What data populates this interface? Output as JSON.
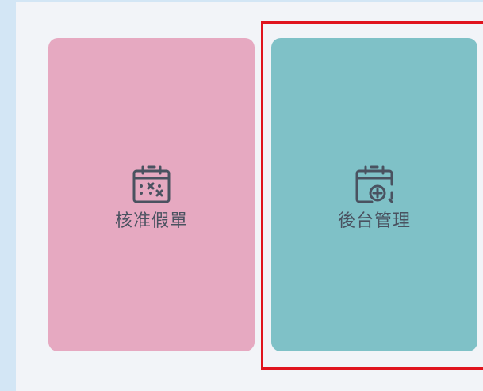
{
  "cards": [
    {
      "label": "核准假單",
      "icon": "calendar-x-icon",
      "color": "#e6a9c1"
    },
    {
      "label": "後台管理",
      "icon": "calendar-plus-icon",
      "color": "#7fc1c7"
    }
  ],
  "colors": {
    "panel_bg": "#f2f4f8",
    "page_bg": "#d3e6f5",
    "icon_text": "#4a5260",
    "highlight": "#e0141e"
  }
}
